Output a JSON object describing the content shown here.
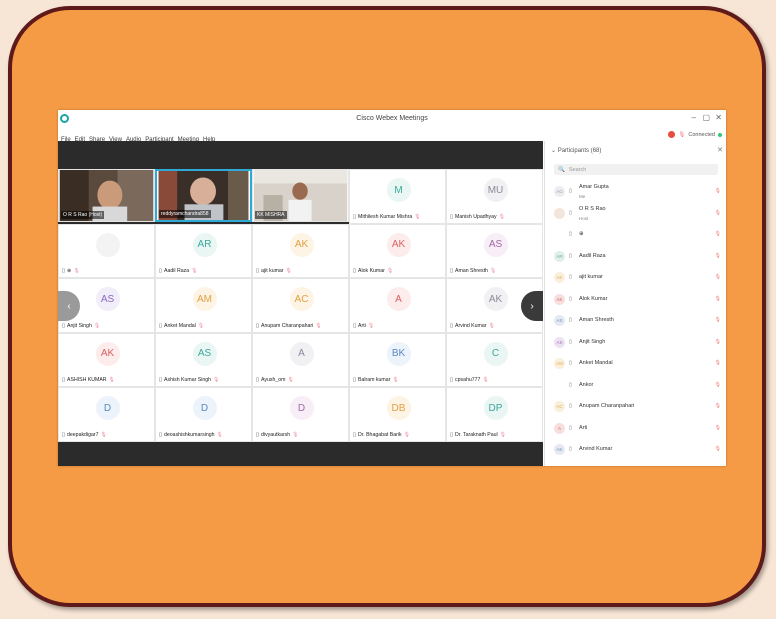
{
  "window": {
    "title": "Cisco Webex Meetings",
    "controls": [
      "–",
      "▢",
      "✕"
    ]
  },
  "menu": [
    "File",
    "Edit",
    "Share",
    "View",
    "Audio",
    "Participant",
    "Meeting",
    "Help"
  ],
  "status": {
    "connected": "Connected"
  },
  "panel": {
    "title": "Participants (68)",
    "search_placeholder": "Search"
  },
  "participants": [
    {
      "initials": "AG",
      "name": "Amar Gupta",
      "sub": "Me",
      "color": "#9aa3b5"
    },
    {
      "initials": "",
      "name": "O R S Rao",
      "sub": "Host",
      "color": "#c08050"
    },
    {
      "initials": "",
      "name": "⊕",
      "sub": "",
      "color": "#ffffff"
    },
    {
      "initials": "AR",
      "name": "Aadil Raza",
      "sub": "",
      "color": "#6ab0a0"
    },
    {
      "initials": "AK",
      "name": "ajit kumar",
      "sub": "",
      "color": "#e0b050"
    },
    {
      "initials": "AK",
      "name": "Alok Kumar",
      "sub": "",
      "color": "#d96060"
    },
    {
      "initials": "AS",
      "name": "Aman Shresth",
      "sub": "",
      "color": "#7a8fc0"
    },
    {
      "initials": "AS",
      "name": "Anjit Singh",
      "sub": "",
      "color": "#a070c0"
    },
    {
      "initials": "AM",
      "name": "Anket Mandal",
      "sub": "",
      "color": "#e0b050"
    },
    {
      "initials": "",
      "name": "Ankor",
      "sub": "",
      "color": "#ffffff"
    },
    {
      "initials": "AC",
      "name": "Anupam Charanpahari",
      "sub": "",
      "color": "#e0b050"
    },
    {
      "initials": "A",
      "name": "Arti",
      "sub": "",
      "color": "#d96060"
    },
    {
      "initials": "AK",
      "name": "Arvind Kumar",
      "sub": "",
      "color": "#7a8fc0"
    }
  ],
  "video_tiles": [
    {
      "name": "O R S Rao",
      "sub": "(Host)"
    },
    {
      "name": "reddyramchandra858",
      "sub": ""
    },
    {
      "name": "KK MISHRA",
      "sub": ""
    }
  ],
  "tiles": [
    {
      "initials": "M",
      "name": "Mithilesh Kumar Mishra",
      "color": "#3aa79a",
      "bg": "#e9f6f4"
    },
    {
      "initials": "MU",
      "name": "Manish Upadhyay",
      "color": "#8a8a9a",
      "bg": "#f1f1f4"
    },
    {
      "initials": "",
      "name": "⊕",
      "color": "#bbbbbb",
      "bg": "#f3f3f3"
    },
    {
      "initials": "AR",
      "name": "Aadil Raza",
      "color": "#3aa79a",
      "bg": "#e9f6f4"
    },
    {
      "initials": "AK",
      "name": "ajit kumar",
      "color": "#e0a040",
      "bg": "#fdf4e5"
    },
    {
      "initials": "AK",
      "name": "Alok Kumar",
      "color": "#d96060",
      "bg": "#fdecec"
    },
    {
      "initials": "AS",
      "name": "Aman Shresth",
      "color": "#a06aa0",
      "bg": "#f7eef7"
    },
    {
      "initials": "AS",
      "name": "Anjit Singh",
      "color": "#8a6ac0",
      "bg": "#f1edf9"
    },
    {
      "initials": "AM",
      "name": "Anket Mandal",
      "color": "#e0a040",
      "bg": "#fdf4e5"
    },
    {
      "initials": "AC",
      "name": "Anupam Charanpahari",
      "color": "#e0a040",
      "bg": "#fdf4e5"
    },
    {
      "initials": "A",
      "name": "Arti",
      "color": "#d96060",
      "bg": "#fdecec"
    },
    {
      "initials": "AK",
      "name": "Arvind Kumar",
      "color": "#8a8a9a",
      "bg": "#f1f1f4"
    },
    {
      "initials": "AK",
      "name": "ASHISH KUMAR",
      "color": "#d96060",
      "bg": "#fdecec"
    },
    {
      "initials": "AS",
      "name": "Ashish Kumar Singh",
      "color": "#3aa79a",
      "bg": "#e9f6f4"
    },
    {
      "initials": "A",
      "name": "Ayush_om",
      "color": "#8a8a9a",
      "bg": "#f1f1f4"
    },
    {
      "initials": "BK",
      "name": "Balram kumar",
      "color": "#5a8ac0",
      "bg": "#ecf3fb"
    },
    {
      "initials": "C",
      "name": "cpsahu777",
      "color": "#3aa79a",
      "bg": "#e9f6f4"
    },
    {
      "initials": "D",
      "name": "deepakdigar7",
      "color": "#5a8ac0",
      "bg": "#ecf3fb"
    },
    {
      "initials": "D",
      "name": "deoashishkumarsingh",
      "color": "#5a8ac0",
      "bg": "#ecf3fb"
    },
    {
      "initials": "D",
      "name": "divyautkarsh",
      "color": "#a06aa0",
      "bg": "#f7eef7"
    },
    {
      "initials": "DB",
      "name": "Dr. Bhagabat Barik",
      "color": "#e0a040",
      "bg": "#fdf4e5"
    },
    {
      "initials": "DP",
      "name": "Dr. Taraknath Paul",
      "color": "#3aa79a",
      "bg": "#e9f6f4"
    }
  ],
  "colors": {
    "frame": "#5e1a1a",
    "background": "#f59a45",
    "stage": "#2b2b2b",
    "accent": "#1aa6a0"
  }
}
